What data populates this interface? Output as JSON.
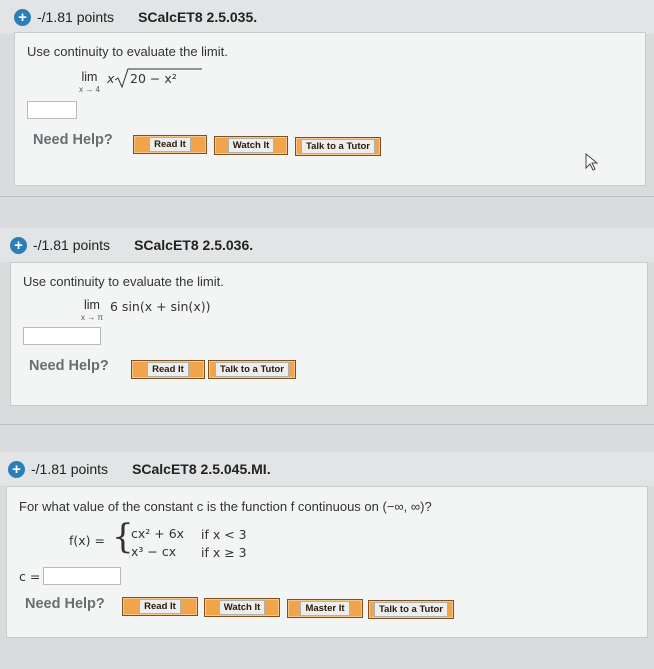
{
  "questions": [
    {
      "points": "-/1.81 points",
      "code": "SCalcET8 2.5.035.",
      "prompt": "Use continuity to evaluate the limit.",
      "lim_word": "lim",
      "lim_sub": "x → 4",
      "expr_pre": "x",
      "radical": "20 − x²",
      "help_label": "Need Help?",
      "buttons": [
        "Read It",
        "Watch It",
        "Talk to a Tutor"
      ]
    },
    {
      "points": "-/1.81 points",
      "code": "SCalcET8 2.5.036.",
      "prompt": "Use continuity to evaluate the limit.",
      "lim_word": "lim",
      "lim_sub": "x → π",
      "expr": "6 sin(x + sin(x))",
      "help_label": "Need Help?",
      "buttons": [
        "Read It",
        "Talk to a Tutor"
      ]
    },
    {
      "points": "-/1.81 points",
      "code": "SCalcET8 2.5.045.MI.",
      "prompt": "For what value of the constant c is the function f continuous on (−∞, ∞)?",
      "f_label": "f(x) =",
      "case1_expr": "cx² + 6x",
      "case1_cond": "if x < 3",
      "case2_expr": "x³ − cx",
      "case2_cond": "if x ≥ 3",
      "answer_label": "c =",
      "help_label": "Need Help?",
      "buttons": [
        "Read It",
        "Watch It",
        "Master It",
        "Talk to a Tutor"
      ]
    }
  ],
  "colors": {
    "plus_icon": "#2b7fb8",
    "button_orange": "#f0a44c",
    "help_text": "#6a6e72"
  }
}
